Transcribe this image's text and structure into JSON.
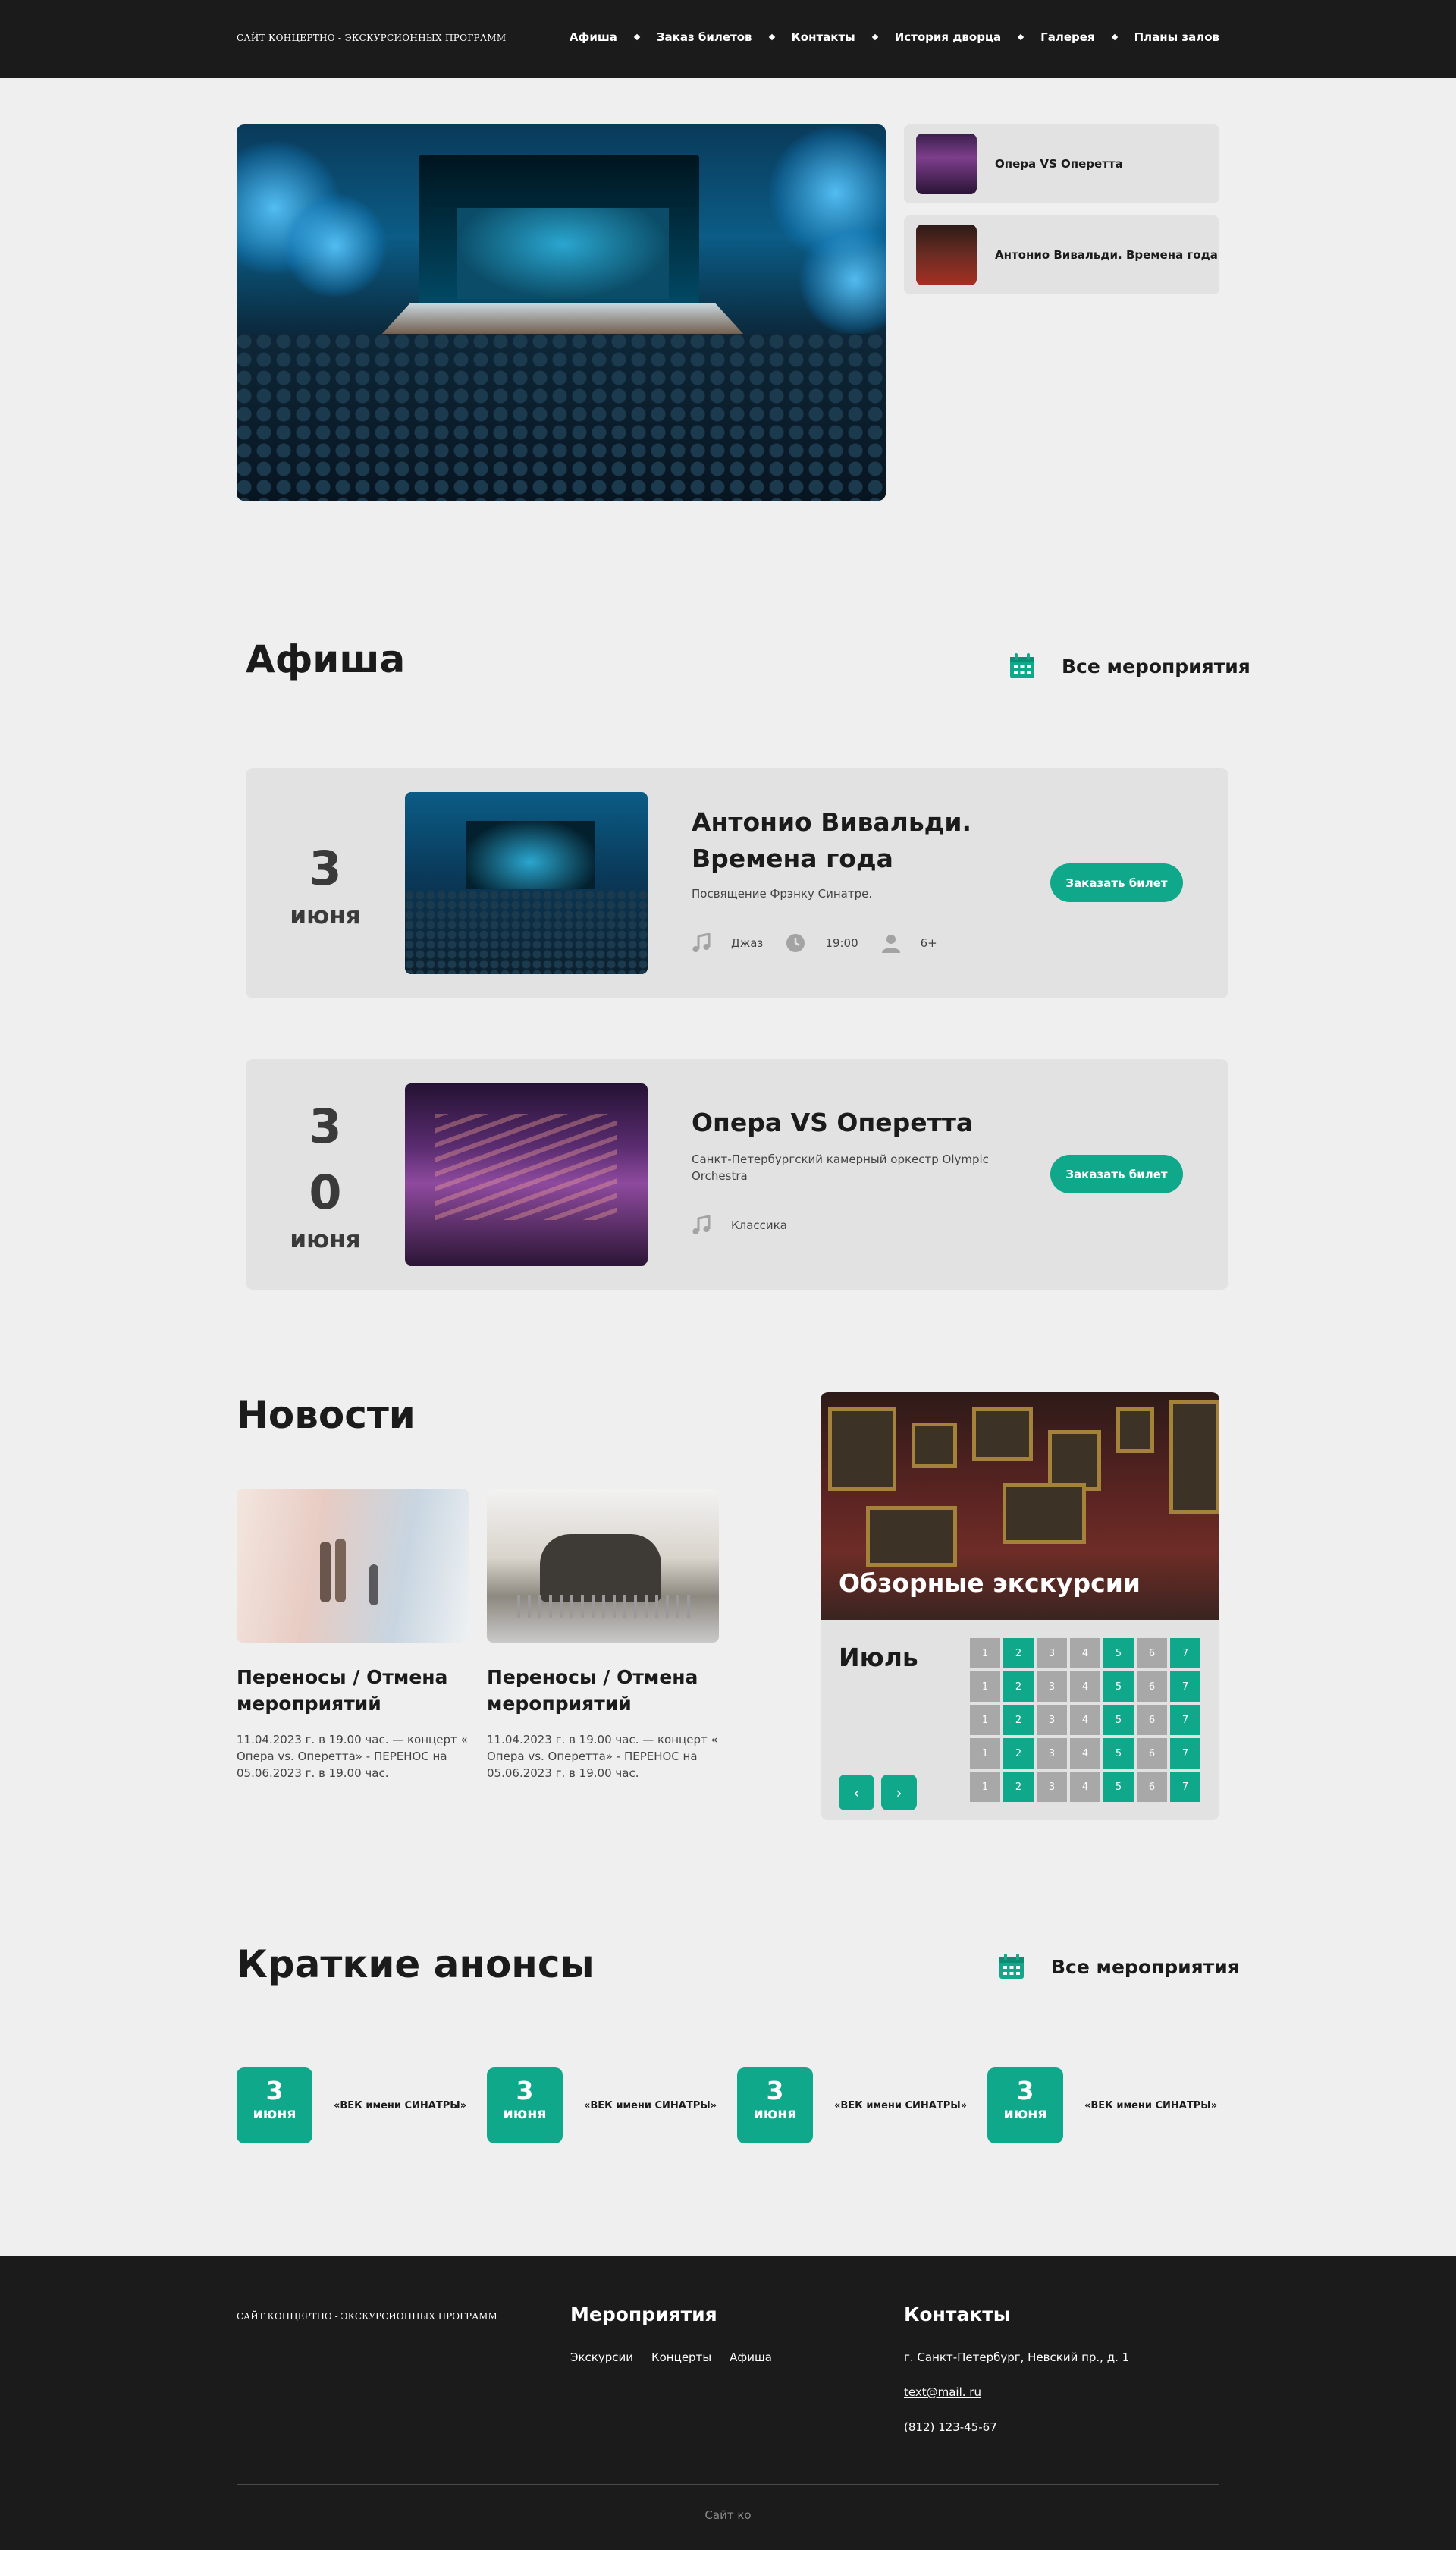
{
  "header": {
    "logo": "САЙТ КОНЦЕРТНО - ЭКСКУРСИОННЫХ ПРОГРАММ",
    "nav": [
      "Афиша",
      "Заказ билетов",
      "Контакты",
      "История дворца",
      "Галерея",
      "Планы залов"
    ]
  },
  "hero": {
    "side_cards": [
      "Опера VS Оперетта",
      "Антонио Вивальди. Времена года"
    ]
  },
  "afisha": {
    "title": "Афиша",
    "all_events": "Все мероприятия",
    "events": [
      {
        "date_num": "3",
        "date_month": "июня",
        "title": "Антонио Вивальди. Времена года",
        "desc": "Посвящение Фрэнку Синатре.",
        "genre": "Джаз",
        "time": "19:00",
        "age": "6+",
        "button": "Заказать билет"
      },
      {
        "date_num_1": "3",
        "date_num_2": "0",
        "date_month": "июня",
        "title": "Опера VS Оперетта",
        "desc": "Санкт-Петербургский камерный оркестр Olympic Orchestra",
        "genre": "Классика",
        "button": "Заказать билет"
      }
    ]
  },
  "news": {
    "title": "Новости",
    "items": [
      {
        "title": "Переносы / Отмена мероприятий",
        "text": "11.04.2023 г. в 19.00 час. — концерт « Опера vs. Оперетта» - ПЕРЕНОС на 05.06.2023 г. в 19.00 час."
      },
      {
        "title": "Переносы / Отмена мероприятий",
        "text": "11.04.2023 г. в 19.00 час. — концерт « Опера vs. Оперетта» - ПЕРЕНОС на 05.06.2023 г. в 19.00 час."
      }
    ]
  },
  "excursion": {
    "title": "Обзорные экскурсии",
    "month": "Июль",
    "days": [
      "1",
      "2",
      "3",
      "4",
      "5",
      "6",
      "7"
    ],
    "prev": "‹",
    "next": "›"
  },
  "announces": {
    "title": "Краткие анонсы",
    "all_events": "Все мероприятия",
    "items": [
      {
        "num": "3",
        "month": "июня",
        "text": "«ВЕК имени СИНАТРЫ»"
      },
      {
        "num": "3",
        "month": "июня",
        "text": "«ВЕК имени СИНАТРЫ»"
      },
      {
        "num": "3",
        "month": "июня",
        "text": "«ВЕК имени СИНАТРЫ»"
      },
      {
        "num": "3",
        "month": "июня",
        "text": "«ВЕК имени СИНАТРЫ»"
      }
    ]
  },
  "footer": {
    "logo": "САЙТ КОНЦЕРТНО - ЭКСКУРСИОННЫХ ПРОГРАММ",
    "events_title": "Мероприятия",
    "links": [
      "Экскурсии",
      "Концерты",
      "Афиша"
    ],
    "contacts_title": "Контакты",
    "address": "г. Санкт-Петербург, Невский пр., д. 1",
    "email": "text@mail. ru",
    "phone": "(812) 123-45-67",
    "copyright": "Сайт ко"
  },
  "colors": {
    "accent": "#0fa88a",
    "dark": "#1b1b1b",
    "background": "#efefef",
    "card": "#e2e2e2"
  }
}
